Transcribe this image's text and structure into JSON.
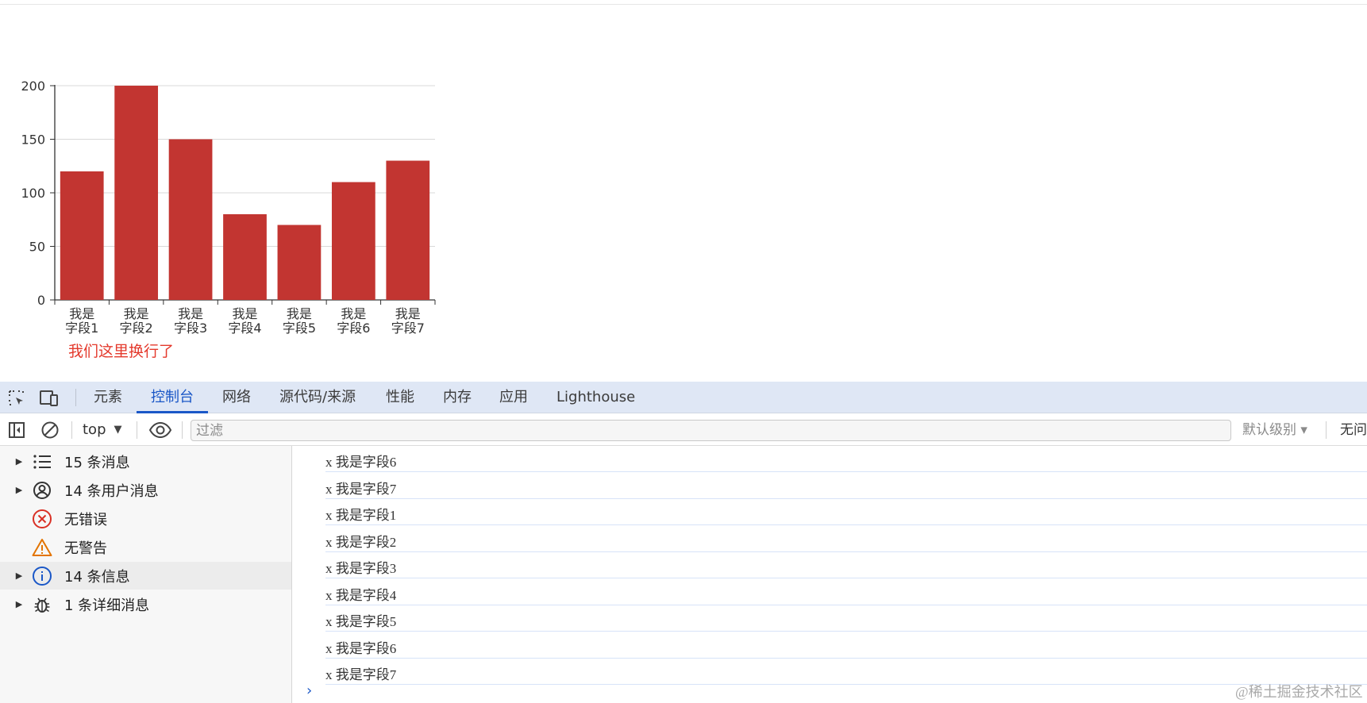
{
  "chart_data": {
    "type": "bar",
    "categories": [
      "我是\n字段1",
      "我是\n字段2",
      "我是\n字段3",
      "我是\n字段4",
      "我是\n字段5",
      "我是\n字段6",
      "我是\n字段7"
    ],
    "series": [
      {
        "values": [
          120,
          200,
          150,
          80,
          70,
          110,
          130
        ]
      }
    ],
    "ylim": [
      0,
      200
    ],
    "yticks": [
      0,
      50,
      100,
      150,
      200
    ],
    "grid": true,
    "bar_color": "#c23531",
    "annotation": "我们这里换行了",
    "annotation_color": "#e4392c"
  },
  "devtools": {
    "tabs": [
      "元素",
      "控制台",
      "网络",
      "源代码/来源",
      "性能",
      "内存",
      "应用",
      "Lighthouse"
    ],
    "active_tab": "控制台",
    "toolbar": {
      "context": "top",
      "filter_placeholder": "过滤",
      "levels": "默认级别 ▾",
      "issues": "无问"
    },
    "sidebar": [
      {
        "label": "15 条消息",
        "icon": "list-icon",
        "expandable": true
      },
      {
        "label": "14 条用户消息",
        "icon": "user-circle-icon",
        "expandable": true
      },
      {
        "label": "无错误",
        "icon": "error-icon",
        "expandable": false
      },
      {
        "label": "无警告",
        "icon": "warning-icon",
        "expandable": false
      },
      {
        "label": "14 条信息",
        "icon": "info-icon",
        "expandable": true,
        "selected": true
      },
      {
        "label": "1 条详细消息",
        "icon": "bug-icon",
        "expandable": true
      }
    ],
    "logs": [
      {
        "text": "x 我是字段6",
        "source": "ec"
      },
      {
        "text": "x 我是字段7",
        "source": "ec"
      },
      {
        "text": "x 我是字段1",
        "source": "ec"
      },
      {
        "text": "x 我是字段2",
        "source": "ec"
      },
      {
        "text": "x 我是字段3",
        "source": "ec"
      },
      {
        "text": "x 我是字段4",
        "source": "ec"
      },
      {
        "text": "x 我是字段5",
        "source": "ec"
      },
      {
        "text": "x 我是字段6",
        "source": "ec"
      },
      {
        "text": "x 我是字段7",
        "source": "ec"
      }
    ],
    "accent_color": "#1a57c7"
  },
  "watermark": "@稀土掘金技术社区"
}
